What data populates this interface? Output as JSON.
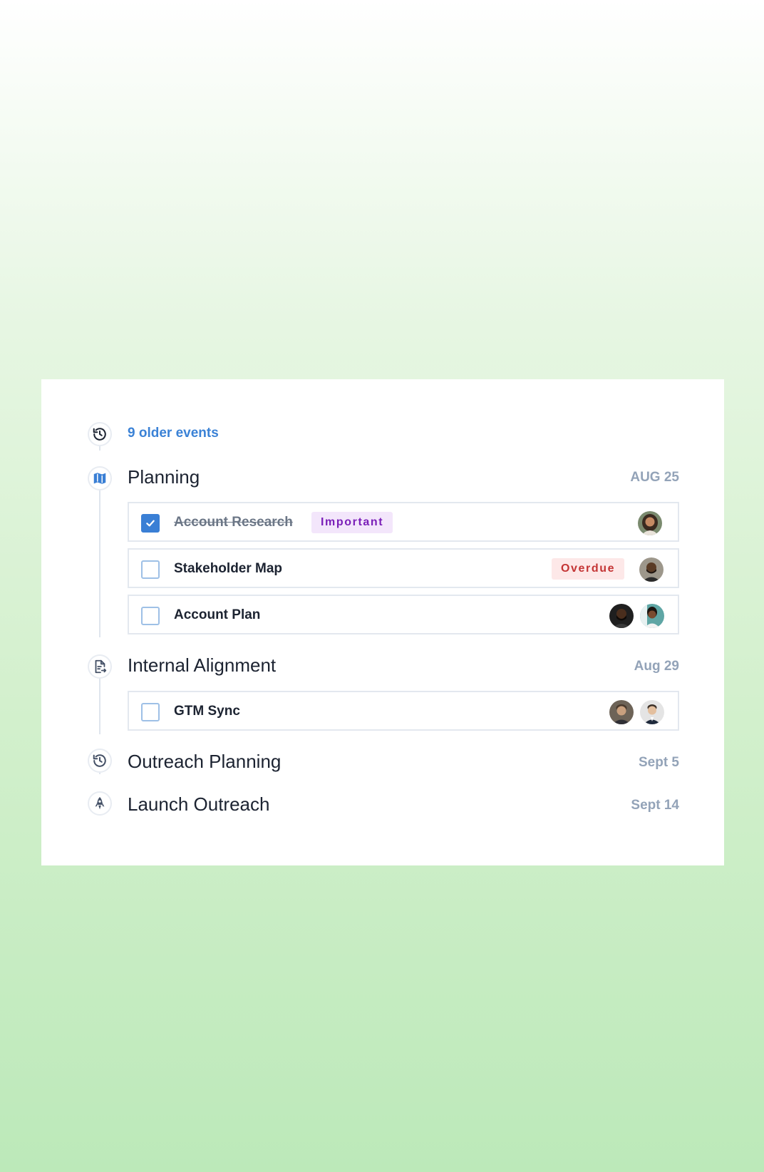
{
  "older_events": {
    "label": "9 older events"
  },
  "sections": [
    {
      "title": "Planning",
      "date": "AUG 25",
      "tasks": [
        {
          "label": "Account Research",
          "done": true,
          "badge": "Important"
        },
        {
          "label": "Stakeholder Map",
          "done": false,
          "badge": "Overdue"
        },
        {
          "label": "Account Plan",
          "done": false
        }
      ]
    },
    {
      "title": "Internal Alignment",
      "date": "Aug 29",
      "tasks": [
        {
          "label": "GTM Sync",
          "done": false
        }
      ]
    },
    {
      "title": "Outreach Planning",
      "date": "Sept 5"
    },
    {
      "title": "Launch Outreach",
      "date": "Sept 14"
    }
  ],
  "colors": {
    "accent": "#3a7fd5",
    "link": "#3b82d6",
    "important_bg": "#f3e6fb",
    "important_text": "#7a1fb8",
    "overdue_bg": "#fde8e8",
    "overdue_text": "#c43535",
    "date_text": "#93a3b8"
  },
  "icons": {
    "older": "history-icon",
    "planning": "map-icon",
    "internal_alignment": "document-share-icon",
    "outreach_planning": "history-icon",
    "launch_outreach": "rocket-icon"
  }
}
